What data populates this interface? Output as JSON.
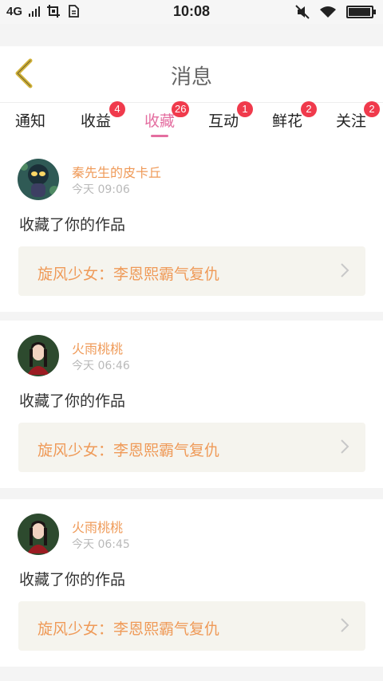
{
  "status_bar": {
    "network": "4G",
    "time": "10:08",
    "battery_level": 0.9
  },
  "header": {
    "title": "消息",
    "back_icon": "chevron-left-icon"
  },
  "tabs": [
    {
      "label": "通知",
      "badge": ""
    },
    {
      "label": "收益",
      "badge": "4"
    },
    {
      "label": "收藏",
      "badge": "26",
      "active": true
    },
    {
      "label": "互动",
      "badge": "1"
    },
    {
      "label": "鲜花",
      "badge": "2"
    },
    {
      "label": "关注",
      "badge": "2"
    }
  ],
  "messages": [
    {
      "user": "秦先生的皮卡丘",
      "time": "今天 09:06",
      "action": "收藏了你的作品",
      "work": "旋风少女：李恩熙霸气复仇"
    },
    {
      "user": "火雨桃桃",
      "time": "今天 06:46",
      "action": "收藏了你的作品",
      "work": "旋风少女：李恩熙霸气复仇"
    },
    {
      "user": "火雨桃桃",
      "time": "今天 06:45",
      "action": "收藏了你的作品",
      "work": "旋风少女：李恩熙霸气复仇"
    }
  ],
  "colors": {
    "accent_pink": "#e46ea0",
    "accent_orange": "#ef9a58",
    "badge_red": "#f03a4c",
    "back_arrow": "#d2b33a"
  }
}
